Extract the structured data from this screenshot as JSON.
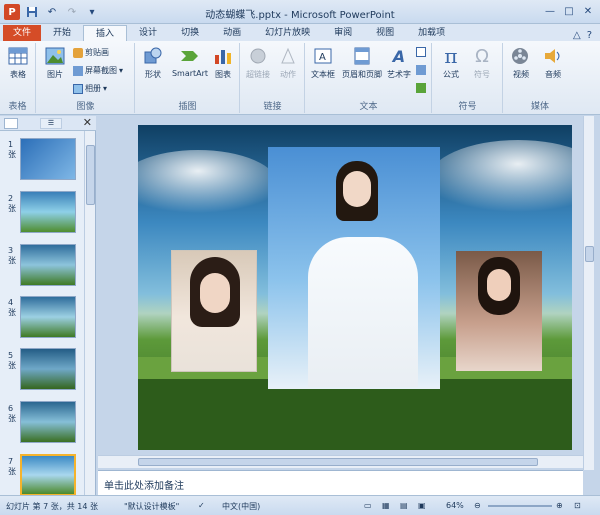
{
  "window": {
    "title": "动态蝴蝶飞.pptx - Microsoft PowerPoint",
    "app_icon": "P"
  },
  "tabs": [
    "文件",
    "开始",
    "插入",
    "设计",
    "切换",
    "动画",
    "幻灯片放映",
    "审阅",
    "视图",
    "加载项"
  ],
  "active_tab": "插入",
  "ribbon": {
    "groups": [
      {
        "label": "表格",
        "buttons": [
          "表格"
        ]
      },
      {
        "label": "图像",
        "buttons": [
          "图片",
          "剪贴画",
          "屏幕截图",
          "相册"
        ]
      },
      {
        "label": "插图",
        "buttons": [
          "形状",
          "SmartArt",
          "图表"
        ]
      },
      {
        "label": "链接",
        "buttons": [
          "超链接",
          "动作"
        ]
      },
      {
        "label": "文本",
        "buttons": [
          "文本框",
          "页眉和页脚",
          "艺术字"
        ]
      },
      {
        "label": "符号",
        "buttons": [
          "公式",
          "符号"
        ]
      },
      {
        "label": "媒体",
        "buttons": [
          "视频",
          "音频"
        ]
      }
    ]
  },
  "slides_pane": {
    "tab_outline": "☰",
    "close": "✕",
    "thumb_label": "张",
    "slide_numbers": [
      "1",
      "2",
      "3",
      "4",
      "5",
      "6",
      "7"
    ],
    "selected": 7
  },
  "notes": {
    "placeholder": "单击此处添加备注"
  },
  "status": {
    "slide_info": "幻灯片 第 7 张，共 14 张",
    "theme": "\"默认设计模板\"",
    "language": "中文(中国)",
    "zoom": "64%"
  },
  "colors": {
    "file_tab": "#d54c27",
    "accent": "#1e395b",
    "selection": "#f5b32c"
  },
  "icons": [
    "save-icon",
    "undo-icon",
    "redo-icon",
    "minimize-icon",
    "maximize-icon",
    "close-icon",
    "help-icon"
  ]
}
